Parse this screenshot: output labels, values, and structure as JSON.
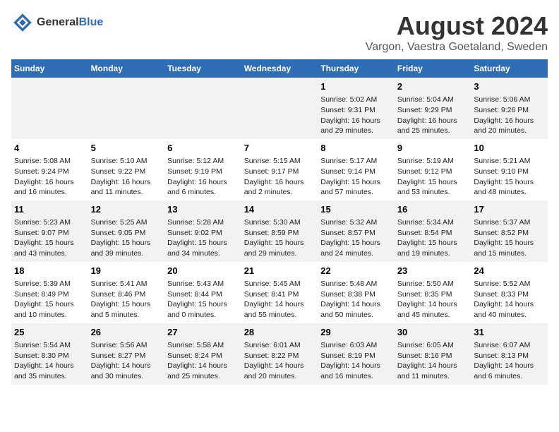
{
  "header": {
    "logo_text_normal": "General",
    "logo_text_bold": "Blue",
    "main_title": "August 2024",
    "subtitle": "Vargon, Vaestra Goetaland, Sweden"
  },
  "calendar": {
    "days_of_week": [
      "Sunday",
      "Monday",
      "Tuesday",
      "Wednesday",
      "Thursday",
      "Friday",
      "Saturday"
    ],
    "weeks": [
      [
        {
          "day": "",
          "info": ""
        },
        {
          "day": "",
          "info": ""
        },
        {
          "day": "",
          "info": ""
        },
        {
          "day": "",
          "info": ""
        },
        {
          "day": "1",
          "info": "Sunrise: 5:02 AM\nSunset: 9:31 PM\nDaylight: 16 hours\nand 29 minutes."
        },
        {
          "day": "2",
          "info": "Sunrise: 5:04 AM\nSunset: 9:29 PM\nDaylight: 16 hours\nand 25 minutes."
        },
        {
          "day": "3",
          "info": "Sunrise: 5:06 AM\nSunset: 9:26 PM\nDaylight: 16 hours\nand 20 minutes."
        }
      ],
      [
        {
          "day": "4",
          "info": "Sunrise: 5:08 AM\nSunset: 9:24 PM\nDaylight: 16 hours\nand 16 minutes."
        },
        {
          "day": "5",
          "info": "Sunrise: 5:10 AM\nSunset: 9:22 PM\nDaylight: 16 hours\nand 11 minutes."
        },
        {
          "day": "6",
          "info": "Sunrise: 5:12 AM\nSunset: 9:19 PM\nDaylight: 16 hours\nand 6 minutes."
        },
        {
          "day": "7",
          "info": "Sunrise: 5:15 AM\nSunset: 9:17 PM\nDaylight: 16 hours\nand 2 minutes."
        },
        {
          "day": "8",
          "info": "Sunrise: 5:17 AM\nSunset: 9:14 PM\nDaylight: 15 hours\nand 57 minutes."
        },
        {
          "day": "9",
          "info": "Sunrise: 5:19 AM\nSunset: 9:12 PM\nDaylight: 15 hours\nand 53 minutes."
        },
        {
          "day": "10",
          "info": "Sunrise: 5:21 AM\nSunset: 9:10 PM\nDaylight: 15 hours\nand 48 minutes."
        }
      ],
      [
        {
          "day": "11",
          "info": "Sunrise: 5:23 AM\nSunset: 9:07 PM\nDaylight: 15 hours\nand 43 minutes."
        },
        {
          "day": "12",
          "info": "Sunrise: 5:25 AM\nSunset: 9:05 PM\nDaylight: 15 hours\nand 39 minutes."
        },
        {
          "day": "13",
          "info": "Sunrise: 5:28 AM\nSunset: 9:02 PM\nDaylight: 15 hours\nand 34 minutes."
        },
        {
          "day": "14",
          "info": "Sunrise: 5:30 AM\nSunset: 8:59 PM\nDaylight: 15 hours\nand 29 minutes."
        },
        {
          "day": "15",
          "info": "Sunrise: 5:32 AM\nSunset: 8:57 PM\nDaylight: 15 hours\nand 24 minutes."
        },
        {
          "day": "16",
          "info": "Sunrise: 5:34 AM\nSunset: 8:54 PM\nDaylight: 15 hours\nand 19 minutes."
        },
        {
          "day": "17",
          "info": "Sunrise: 5:37 AM\nSunset: 8:52 PM\nDaylight: 15 hours\nand 15 minutes."
        }
      ],
      [
        {
          "day": "18",
          "info": "Sunrise: 5:39 AM\nSunset: 8:49 PM\nDaylight: 15 hours\nand 10 minutes."
        },
        {
          "day": "19",
          "info": "Sunrise: 5:41 AM\nSunset: 8:46 PM\nDaylight: 15 hours\nand 5 minutes."
        },
        {
          "day": "20",
          "info": "Sunrise: 5:43 AM\nSunset: 8:44 PM\nDaylight: 15 hours\nand 0 minutes."
        },
        {
          "day": "21",
          "info": "Sunrise: 5:45 AM\nSunset: 8:41 PM\nDaylight: 14 hours\nand 55 minutes."
        },
        {
          "day": "22",
          "info": "Sunrise: 5:48 AM\nSunset: 8:38 PM\nDaylight: 14 hours\nand 50 minutes."
        },
        {
          "day": "23",
          "info": "Sunrise: 5:50 AM\nSunset: 8:35 PM\nDaylight: 14 hours\nand 45 minutes."
        },
        {
          "day": "24",
          "info": "Sunrise: 5:52 AM\nSunset: 8:33 PM\nDaylight: 14 hours\nand 40 minutes."
        }
      ],
      [
        {
          "day": "25",
          "info": "Sunrise: 5:54 AM\nSunset: 8:30 PM\nDaylight: 14 hours\nand 35 minutes."
        },
        {
          "day": "26",
          "info": "Sunrise: 5:56 AM\nSunset: 8:27 PM\nDaylight: 14 hours\nand 30 minutes."
        },
        {
          "day": "27",
          "info": "Sunrise: 5:58 AM\nSunset: 8:24 PM\nDaylight: 14 hours\nand 25 minutes."
        },
        {
          "day": "28",
          "info": "Sunrise: 6:01 AM\nSunset: 8:22 PM\nDaylight: 14 hours\nand 20 minutes."
        },
        {
          "day": "29",
          "info": "Sunrise: 6:03 AM\nSunset: 8:19 PM\nDaylight: 14 hours\nand 16 minutes."
        },
        {
          "day": "30",
          "info": "Sunrise: 6:05 AM\nSunset: 8:16 PM\nDaylight: 14 hours\nand 11 minutes."
        },
        {
          "day": "31",
          "info": "Sunrise: 6:07 AM\nSunset: 8:13 PM\nDaylight: 14 hours\nand 6 minutes."
        }
      ]
    ]
  }
}
